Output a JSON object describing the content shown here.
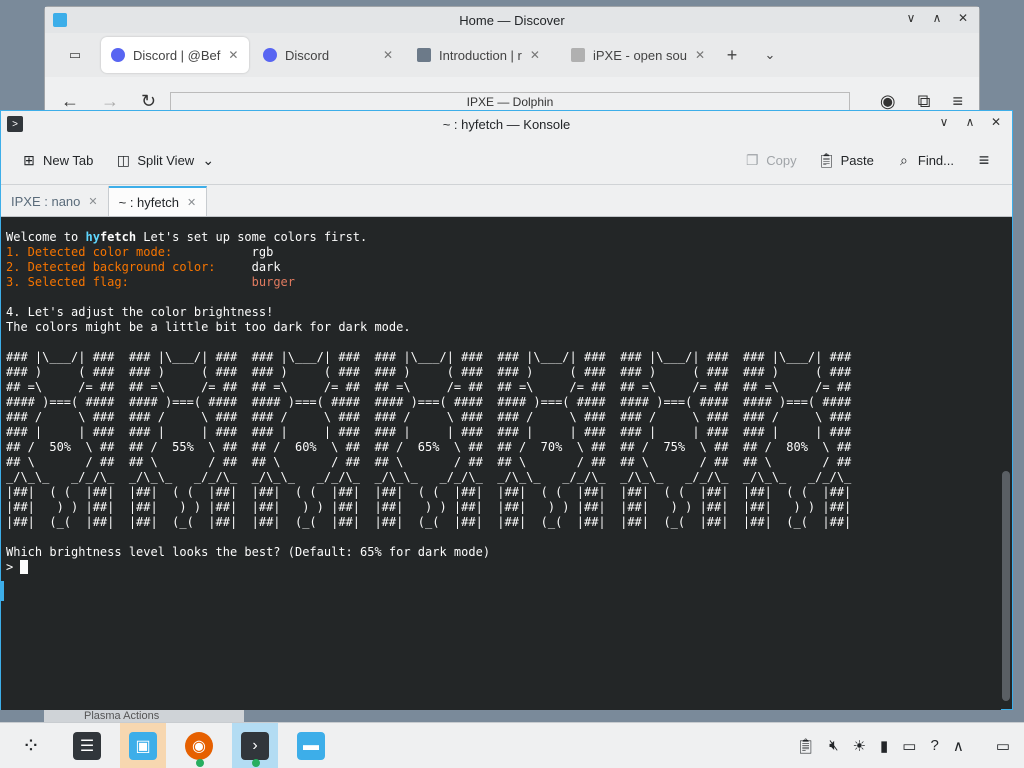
{
  "browser": {
    "title": "Home — Discover",
    "tabs": [
      {
        "label": "Discord | @Bef",
        "active": true
      },
      {
        "label": "Discord",
        "active": false
      },
      {
        "label": "Introduction | r",
        "active": false
      },
      {
        "label": "iPXE - open sou",
        "active": false
      }
    ],
    "new_tab_label": "+"
  },
  "dolphin": {
    "title": "IPXE — Dolphin"
  },
  "konsole": {
    "title": "~ : hyfetch — Konsole",
    "toolbar": {
      "new_tab": "New Tab",
      "split_view": "Split View",
      "copy": "Copy",
      "paste": "Paste",
      "find": "Find..."
    },
    "tabs": [
      {
        "label": "IPXE : nano",
        "active": false
      },
      {
        "label": "~ : hyfetch",
        "active": true
      }
    ]
  },
  "terminal": {
    "welcome_prefix": "Welcome to ",
    "welcome_hy": "hy",
    "welcome_fetch": "fetch",
    "welcome_suffix": " Let's set up some colors first.",
    "line1_label": "1. Detected color mode:           ",
    "line1_value": "rgb",
    "line2_label": "2. Detected background color:     ",
    "line2_value": "dark",
    "line3_label": "3. Selected flag:                 ",
    "line3_value": "burger",
    "step4": "4. Let's adjust the color brightness!",
    "step4_note": "The colors might be a little bit too dark for dark mode.",
    "art": [
      "### |\\___/| ###  ### |\\___/| ###  ### |\\___/| ###  ### |\\___/| ###  ### |\\___/| ###  ### |\\___/| ###  ### |\\___/| ###",
      "### )     ( ###  ### )     ( ###  ### )     ( ###  ### )     ( ###  ### )     ( ###  ### )     ( ###  ### )     ( ###",
      "## =\\     /= ##  ## =\\     /= ##  ## =\\     /= ##  ## =\\     /= ##  ## =\\     /= ##  ## =\\     /= ##  ## =\\     /= ##",
      "#### )===( ####  #### )===( ####  #### )===( ####  #### )===( ####  #### )===( ####  #### )===( ####  #### )===( ####",
      "### /     \\ ###  ### /     \\ ###  ### /     \\ ###  ### /     \\ ###  ### /     \\ ###  ### /     \\ ###  ### /     \\ ###",
      "### |     | ###  ### |     | ###  ### |     | ###  ### |     | ###  ### |     | ###  ### |     | ###  ### |     | ###",
      "## /  50%  \\ ##  ## /  55%  \\ ##  ## /  60%  \\ ##  ## /  65%  \\ ##  ## /  70%  \\ ##  ## /  75%  \\ ##  ## /  80%  \\ ##",
      "## \\       / ##  ## \\       / ##  ## \\       / ##  ## \\       / ##  ## \\       / ##  ## \\       / ##  ## \\       / ##",
      "_/\\_\\_   _/_/\\_  _/\\_\\_   _/_/\\_  _/\\_\\_   _/_/\\_  _/\\_\\_   _/_/\\_  _/\\_\\_   _/_/\\_  _/\\_\\_   _/_/\\_  _/\\_\\_   _/_/\\_",
      "|##|  ( (  |##|  |##|  ( (  |##|  |##|  ( (  |##|  |##|  ( (  |##|  |##|  ( (  |##|  |##|  ( (  |##|  |##|  ( (  |##|",
      "|##|   ) ) |##|  |##|   ) ) |##|  |##|   ) ) |##|  |##|   ) ) |##|  |##|   ) ) |##|  |##|   ) ) |##|  |##|   ) ) |##|",
      "|##|  (_(  |##|  |##|  (_(  |##|  |##|  (_(  |##|  |##|  (_(  |##|  |##|  (_(  |##|  |##|  (_(  |##|  |##|  (_(  |##|"
    ],
    "question": "Which brightness level looks the best? (Default: 65% for dark mode)",
    "prompt": "> "
  },
  "plasma": {
    "label": "Plasma Actions"
  },
  "colors": {
    "accent": "#3daee9",
    "terminal_bg": "#232627",
    "orange": "#f67400",
    "teal": "#1abc9c"
  }
}
